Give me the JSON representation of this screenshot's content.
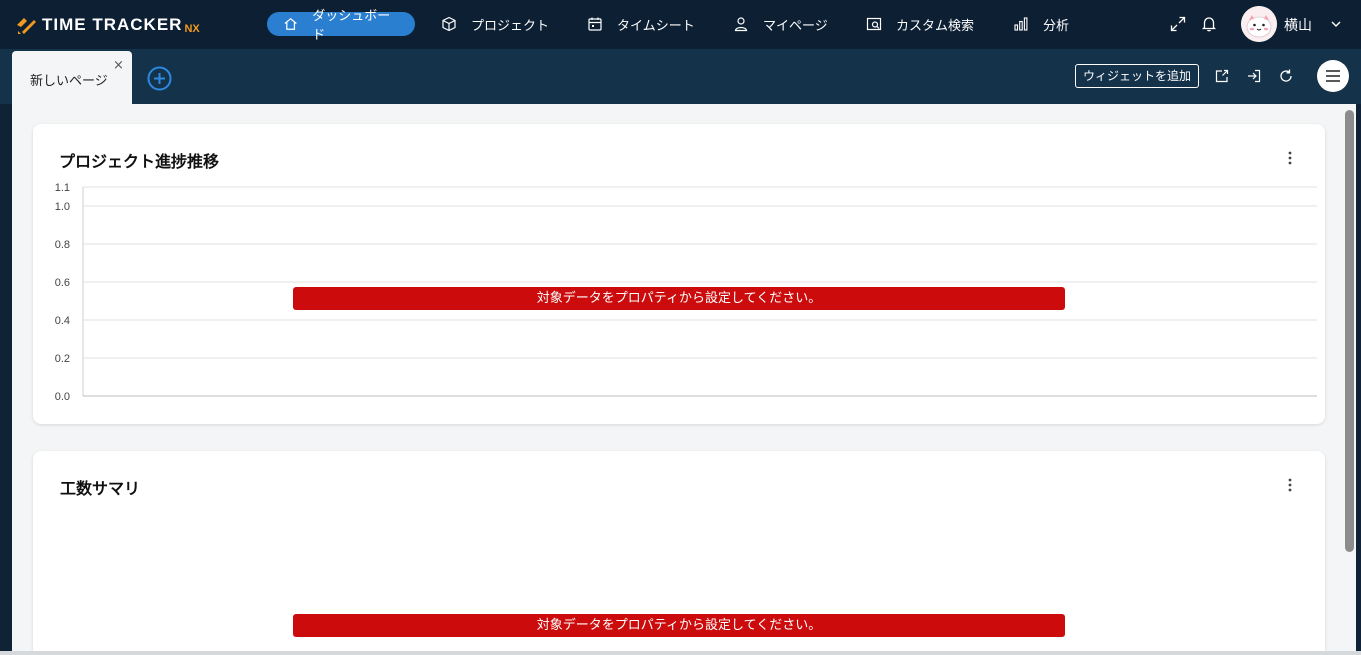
{
  "app": {
    "logo_text": "TIME TRACKER",
    "logo_suffix": "NX",
    "brand_accent": "#f29a1f",
    "nav_active_color": "#2b7fd1",
    "error_color": "#cc0c0c"
  },
  "nav": {
    "items": [
      {
        "label": "ダッシュボード",
        "icon": "home-icon",
        "active": true
      },
      {
        "label": "プロジェクト",
        "icon": "cube-icon",
        "active": false
      },
      {
        "label": "タイムシート",
        "icon": "calendar-icon",
        "active": false
      },
      {
        "label": "マイページ",
        "icon": "user-icon",
        "active": false
      },
      {
        "label": "カスタム検索",
        "icon": "search-window-icon",
        "active": false
      },
      {
        "label": "分析",
        "icon": "bar-chart-icon",
        "active": false
      }
    ]
  },
  "user": {
    "name": "横山"
  },
  "tabs": {
    "page_tab_label": "新しいページ",
    "close_glyph": "×",
    "add_widget_label": "ウィジェットを追加"
  },
  "widgets": [
    {
      "title": "プロジェクト進捗推移",
      "message": "対象データをプロパティから設定してください。"
    },
    {
      "title": "工数サマリ",
      "message": "対象データをプロパティから設定してください。"
    }
  ],
  "chart_data": {
    "type": "line",
    "title": "",
    "xlabel": "",
    "ylabel": "",
    "ylim": [
      0,
      1.1
    ],
    "yticks": [
      "0.0",
      "0.2",
      "0.4",
      "0.6",
      "0.8",
      "1.0",
      "1.1"
    ],
    "series": [],
    "grid": true
  }
}
